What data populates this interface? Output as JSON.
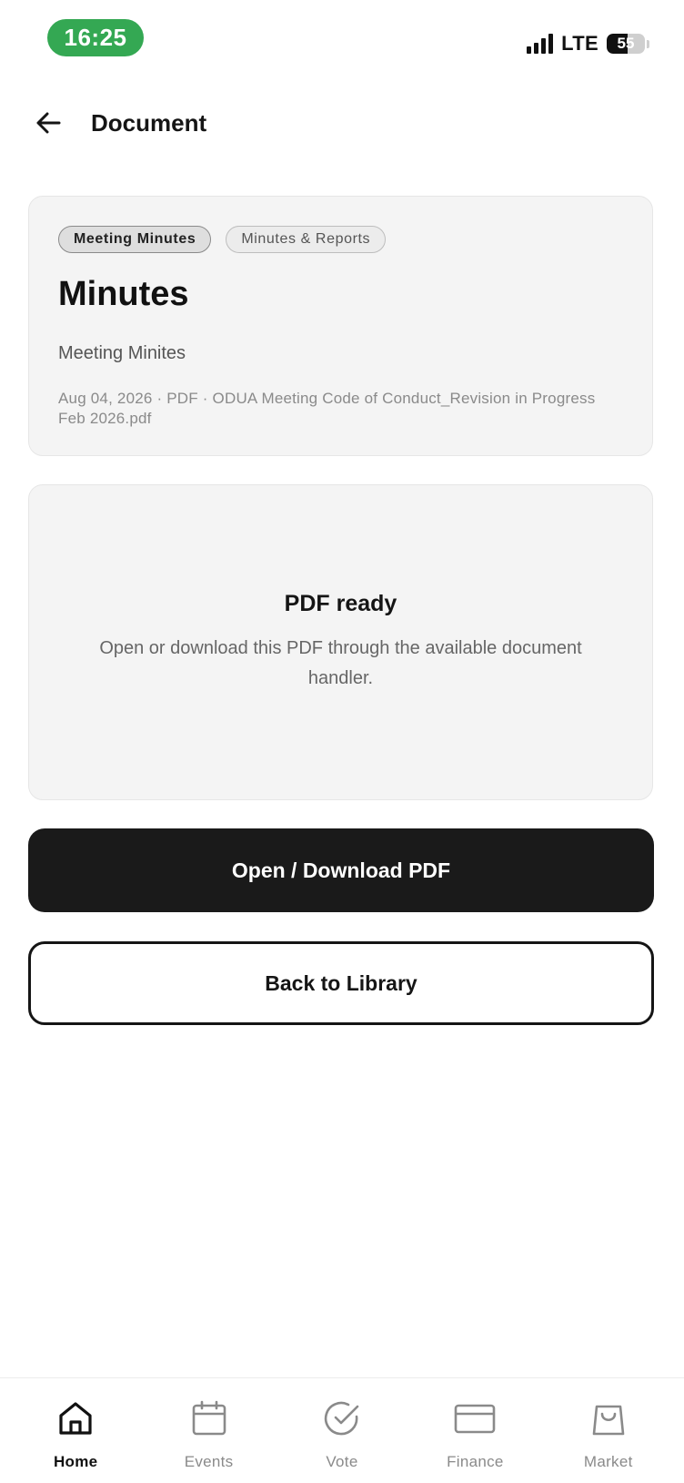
{
  "status_bar": {
    "time": "16:25",
    "network": "LTE",
    "battery_level": "55",
    "battery_fraction": 0.55
  },
  "header": {
    "title": "Document"
  },
  "document": {
    "tags": [
      "Meeting Minutes",
      "Minutes & Reports"
    ],
    "title": "Minutes",
    "subtitle": "Meeting Minites",
    "meta": "Aug 04, 2026 · PDF · ODUA Meeting Code of Conduct_Revision in Progress Feb 2026.pdf"
  },
  "preview": {
    "title": "PDF ready",
    "description": "Open or download this PDF through the available document handler."
  },
  "actions": {
    "primary_label": "Open / Download PDF",
    "secondary_label": "Back to Library"
  },
  "bottom_nav": {
    "items": [
      {
        "label": "Home",
        "icon": "home-icon",
        "active": true
      },
      {
        "label": "Events",
        "icon": "calendar-icon",
        "active": false
      },
      {
        "label": "Vote",
        "icon": "check-circle-icon",
        "active": false
      },
      {
        "label": "Finance",
        "icon": "card-icon",
        "active": false
      },
      {
        "label": "Market",
        "icon": "shopping-bag-icon",
        "active": false
      }
    ]
  },
  "colors": {
    "status_pill": "#34a853",
    "primary_button": "#1a1a1a",
    "card_background": "#f4f4f4",
    "inactive_nav": "#8a8a8a"
  }
}
